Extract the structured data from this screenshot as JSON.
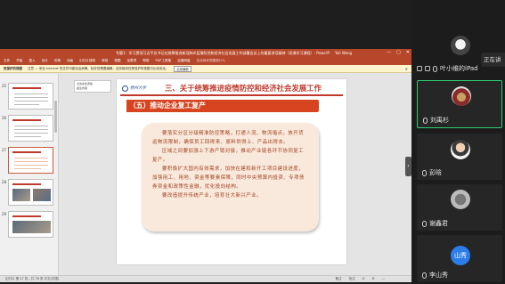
{
  "ppt": {
    "title": "专题1：学习贯彻习近平总书记在统筹推进新冠肺炎疫情防控和经济社会发展工作部署会议上的重要讲话精神（党课学习课程）- PowerPoint",
    "user": "Yali Wang",
    "window_controls": [
      "—",
      "□",
      "✕"
    ],
    "menu": [
      "文件",
      "开始",
      "插入",
      "设计",
      "切换",
      "动画",
      "幻灯片放映",
      "审阅",
      "视图",
      "加载项",
      "帮助",
      "PDF工具集",
      "百度网盘",
      "告诉我你想要做什么"
    ],
    "warning": {
      "label": "受保护的视图",
      "text": "注意 — 来自 Internet 的文件可能包含病毒。除非您需要编辑，否则保持在受保护的视图中比较安全。",
      "button": "启用编辑"
    },
    "thumbnails": [
      {
        "num": "25"
      },
      {
        "num": "26"
      },
      {
        "num": "27"
      },
      {
        "num": "28"
      },
      {
        "num": "29"
      }
    ],
    "note_box": [
      "点击此处添加",
      "备注内容"
    ],
    "slide": {
      "logo_text": "扬州大学",
      "heading": "三、关于统筹推进疫情防控和经济社会发展工作",
      "subtitle": "（五）推动企业复工复产",
      "paragraphs": [
        "要落实分区分级精准防控策略，打通人流、物流堵点，放开货运物流限制，确保员工回得来、原料供得上、产品出得去。",
        "区域之间要加强上下游产销对接，推动产业链各环节协同复工复产。",
        "要积极扩大国内有效需求，加快在建和新开工项目建设进度，加强用工、用地、资金等要素保障，同时中央预算内投资、专项债券资金和政策性金融，优化投向结构。",
        "要改造提升传统产业，培育壮大新兴产业。"
      ]
    },
    "status": {
      "left": "幻灯片 第 27 张，共 78 张    中文(中国)",
      "right": [
        "备注",
        "批注",
        "⊟",
        "⊞",
        "—"
      ]
    }
  },
  "meeting": {
    "speaking_label": "正在讲",
    "participants": [
      {
        "name": "叶小维的iPad"
      },
      {
        "name": "刘禹杉"
      },
      {
        "name": "彭晗"
      },
      {
        "name": "谢鑫君"
      },
      {
        "name": "李山秀",
        "avatar_text": "山秀"
      }
    ]
  }
}
